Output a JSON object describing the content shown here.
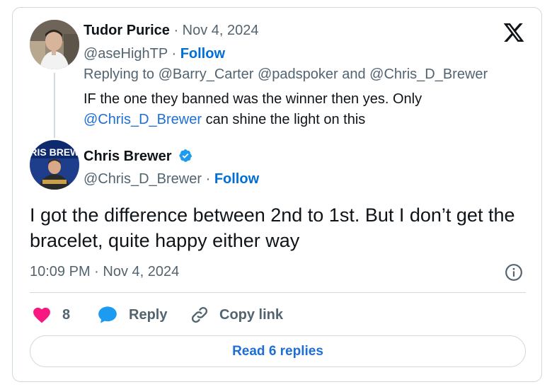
{
  "reply_tweet": {
    "author_name": "Tudor Purice",
    "date": "Nov 4, 2024",
    "handle": "@aseHighTP",
    "follow_label": "Follow",
    "replying_prefix": "Replying to",
    "replying_to_1": "@Barry_Carter",
    "replying_to_2": "@padspoker",
    "replying_and": "and",
    "replying_to_3": "@Chris_D_Brewer",
    "text_line1": "IF the one they banned was the winner then yes. Only",
    "text_mention": "@Chris_D_Brewer",
    "text_line2_rest": " can shine the light on this"
  },
  "main_tweet": {
    "author_name": "Chris Brewer",
    "verified": true,
    "handle": "@Chris_D_Brewer",
    "follow_label": "Follow",
    "text": "I got the difference between 2nd to 1st. But I don’t get the bracelet, quite happy either way",
    "timestamp": "10:09 PM · Nov 4, 2024",
    "avatar_banner_text": "HRIS BREWE"
  },
  "actions": {
    "like_count": "8",
    "reply_label": "Reply",
    "copy_link_label": "Copy link"
  },
  "read_replies_label": "Read 6 replies",
  "separator": "·",
  "colors": {
    "accent": "#1d6fd6",
    "like": "#f91880",
    "reply_icon": "#1d9bf0",
    "muted": "#536471",
    "border": "#cfd9de"
  }
}
